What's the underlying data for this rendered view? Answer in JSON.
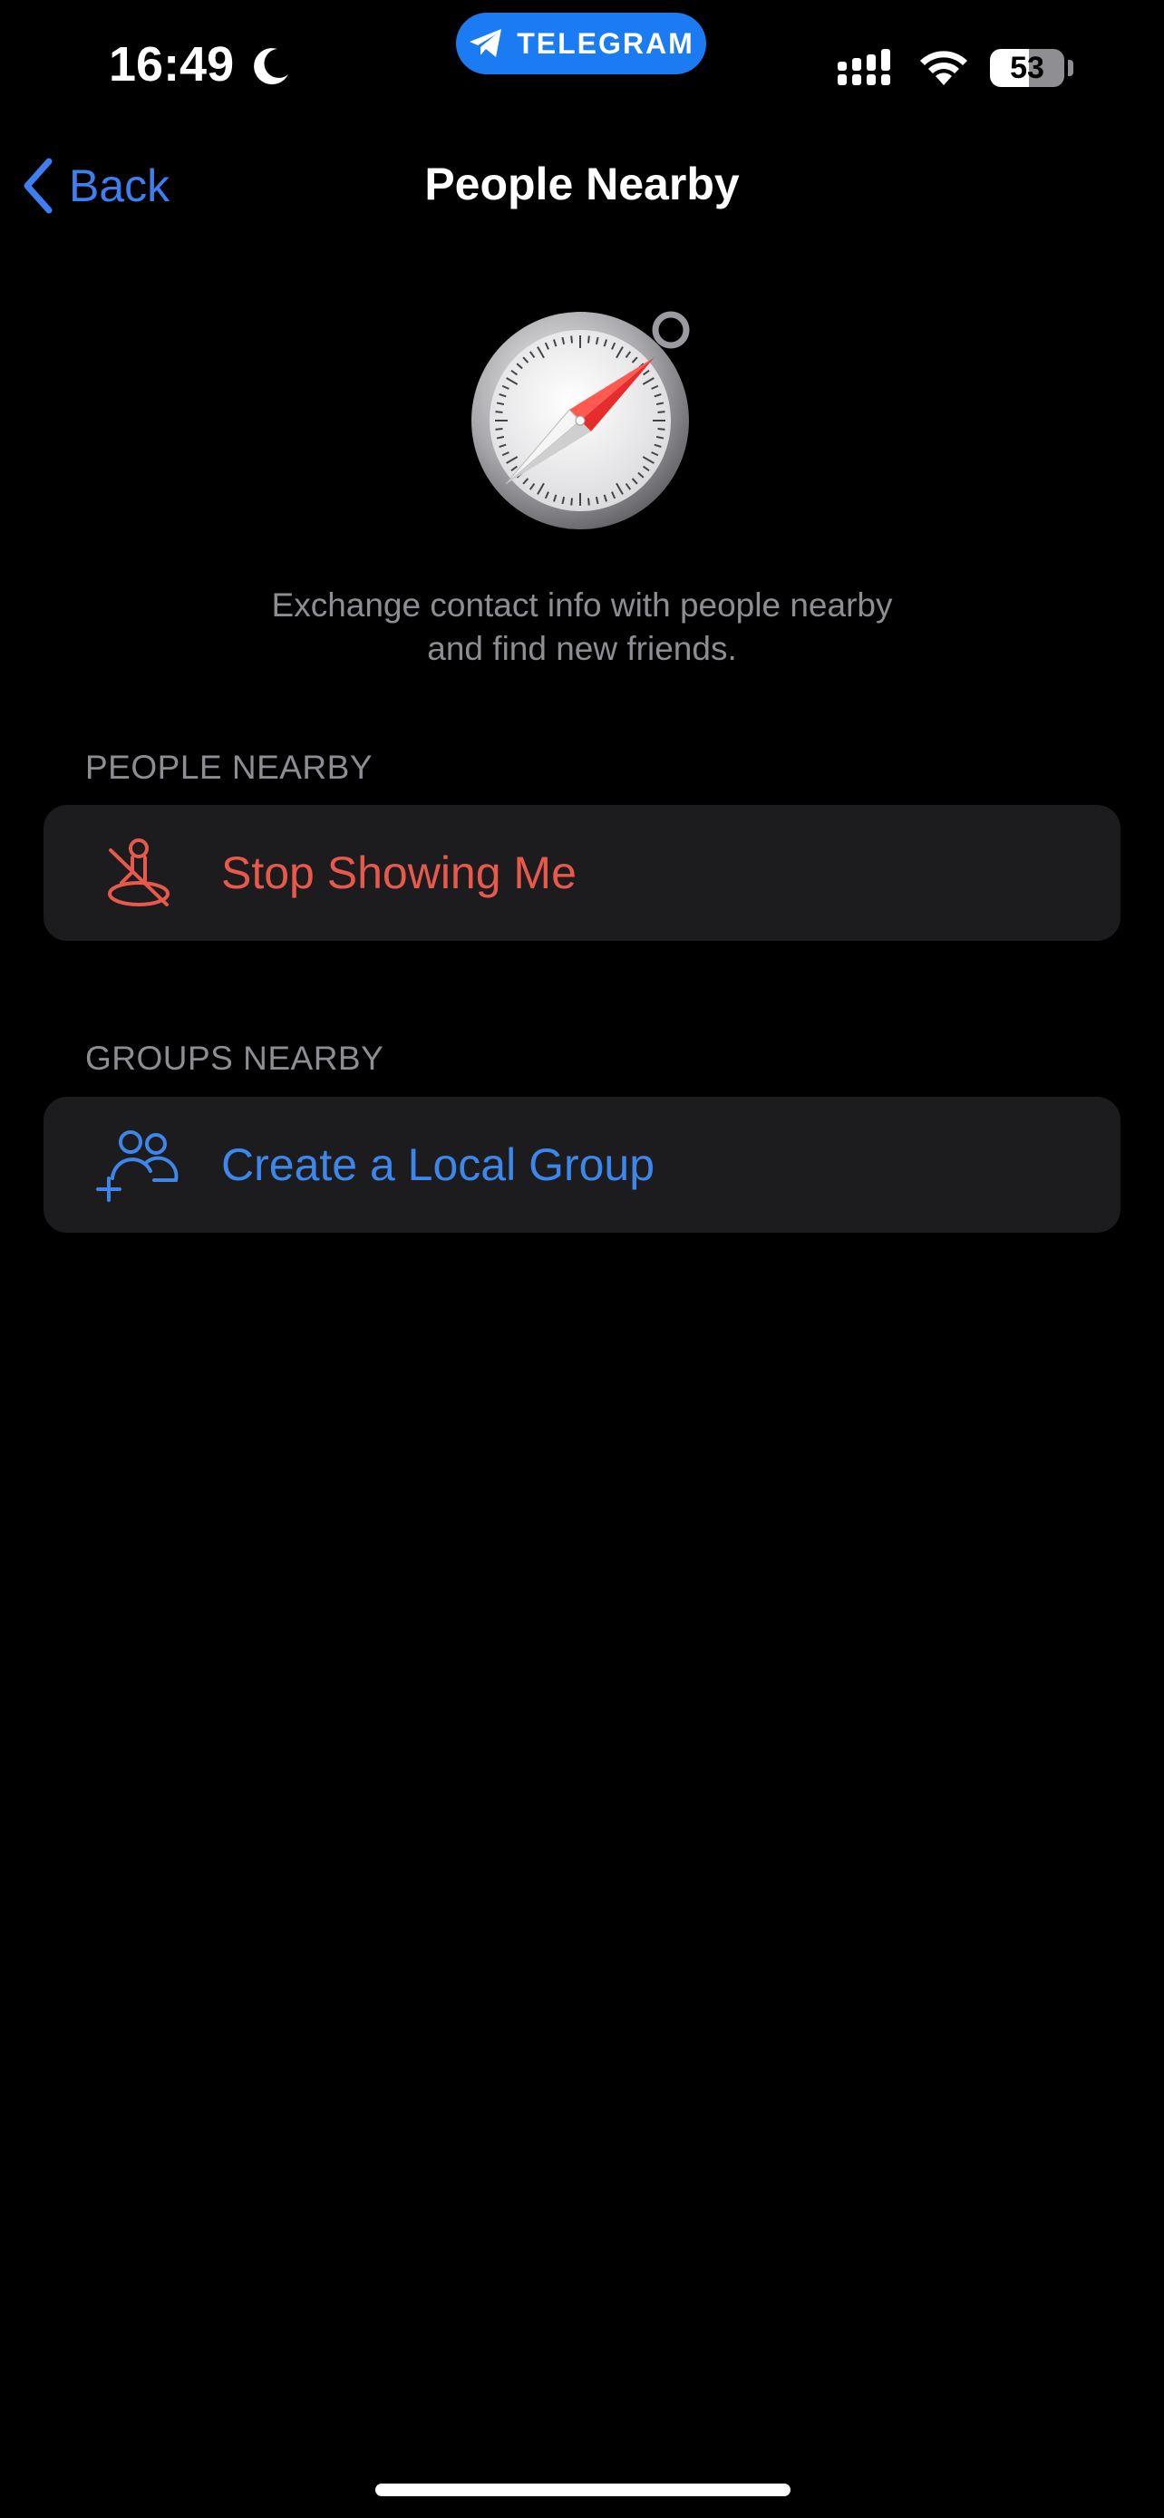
{
  "status_bar": {
    "time": "16:49",
    "pill_label": "TELEGRAM",
    "battery_percent": "53",
    "battery_level": 0.53,
    "moon_icon": "moon-icon",
    "signal_icon": "cellular-signal-icon",
    "wifi_icon": "wifi-icon"
  },
  "nav": {
    "back_label": "Back",
    "title": "People Nearby"
  },
  "hero": {
    "icon": "compass-icon",
    "description_line1": "Exchange contact info with people nearby",
    "description_line2": "and find new friends."
  },
  "sections": {
    "people": {
      "header": "PEOPLE NEARBY",
      "action_label": "Stop Showing Me",
      "action_icon": "location-off-icon",
      "action_color": "#e9594b"
    },
    "groups": {
      "header": "GROUPS NEARBY",
      "action_label": "Create a Local Group",
      "action_icon": "add-group-icon",
      "action_color": "#3d86ea"
    }
  },
  "colors": {
    "background": "#000000",
    "cell_background": "#1c1c1e",
    "accent_blue": "#3d7ff0",
    "telegram_blue": "#1a7bf2",
    "secondary_text": "#8d8d93"
  }
}
